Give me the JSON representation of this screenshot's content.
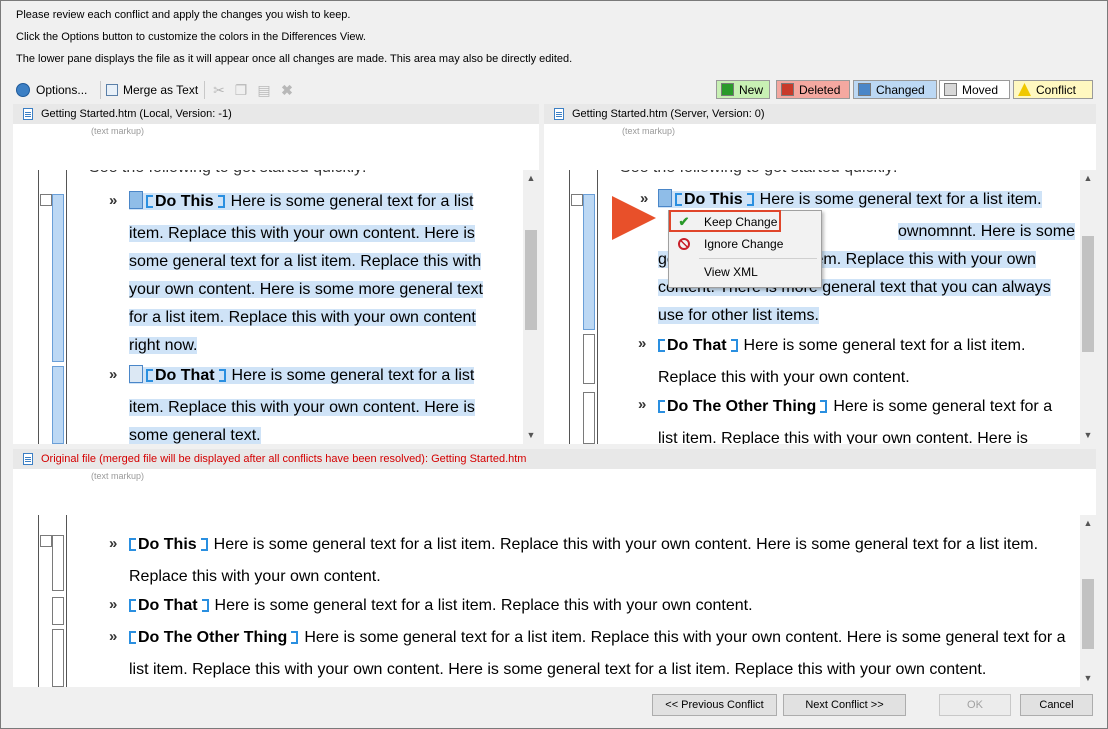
{
  "instructions": [
    "Please review each conflict and apply the changes you wish to keep.",
    "Click the Options button to customize the colors in the Differences View.",
    "The lower pane displays the file as it will appear once all changes are made. This area may also be directly edited."
  ],
  "toolbar": {
    "options_label": "Options...",
    "merge_label": "Merge as Text"
  },
  "legend": {
    "new": {
      "label": "New",
      "color": "#c8f0b4"
    },
    "deleted": {
      "label": "Deleted",
      "color": "#f4a8a0"
    },
    "changed": {
      "label": "Changed",
      "color": "#bcd8f4"
    },
    "moved": {
      "label": "Moved",
      "color": "#ffffff"
    },
    "conflict": {
      "label": "Conflict",
      "color": "#fff8c0"
    }
  },
  "left_pane": {
    "title": "Getting Started.htm (Local, Version: -1)",
    "markup_label": "(text markup)",
    "partial_line": "See the following to get started quickly:",
    "items": [
      {
        "heading": "Do This",
        "lines": [
          "Here is some general text for a list",
          "item. Replace this with your own content. Here is",
          "some general text for a list item. Replace this with",
          "your own content. Here is some more general text",
          "for a list item. Replace this with your own content",
          "right now."
        ]
      },
      {
        "heading": "Do That",
        "lines": [
          "Here is some general text for a list",
          "item. Replace this with your own content. Here is",
          "some general text."
        ]
      }
    ]
  },
  "right_pane": {
    "title": "Getting Started.htm (Server, Version: 0)",
    "markup_label": "(text markup)",
    "partial_line": "See the following to get started quickly:",
    "items": [
      {
        "heading": "Do This",
        "lines": [
          "Here is some general text for a list item.",
          "ownomnnt. Here is some",
          "general text for a list item. Replace this with your own",
          "content. There is more general text that you can always",
          "use for other list items."
        ]
      },
      {
        "heading": "Do That",
        "lines": [
          "Here is some general text for a list item.",
          "Replace this with your own content."
        ]
      },
      {
        "heading": "Do The Other Thing",
        "lines": [
          "Here is some general text for a",
          "list item. Replace this with your own content. Here is"
        ]
      }
    ]
  },
  "context_menu": {
    "keep": "Keep Change",
    "ignore": "Ignore Change",
    "view_xml": "View XML"
  },
  "bottom_pane": {
    "title": "Original file (merged file will be displayed after all conflicts have been resolved): Getting Started.htm",
    "markup_label": "(text markup)",
    "items": [
      {
        "heading": "Do This",
        "lines": [
          "Here is some general text for a list item. Replace this with your own content. Here is some general text for a list item.",
          "Replace this with your own content."
        ]
      },
      {
        "heading": "Do That",
        "lines": [
          "Here is some general text for a list item. Replace this with your own content."
        ]
      },
      {
        "heading": "Do The Other Thing",
        "lines": [
          "Here is some general text for a list item. Replace this with your own content. Here is some general text for a",
          "list item. Replace this with your own content. Here is some general text for a list item. Replace this with your own content."
        ]
      }
    ]
  },
  "buttons": {
    "prev": "<< Previous Conflict",
    "next": "Next Conflict >>",
    "ok": "OK",
    "cancel": "Cancel"
  }
}
